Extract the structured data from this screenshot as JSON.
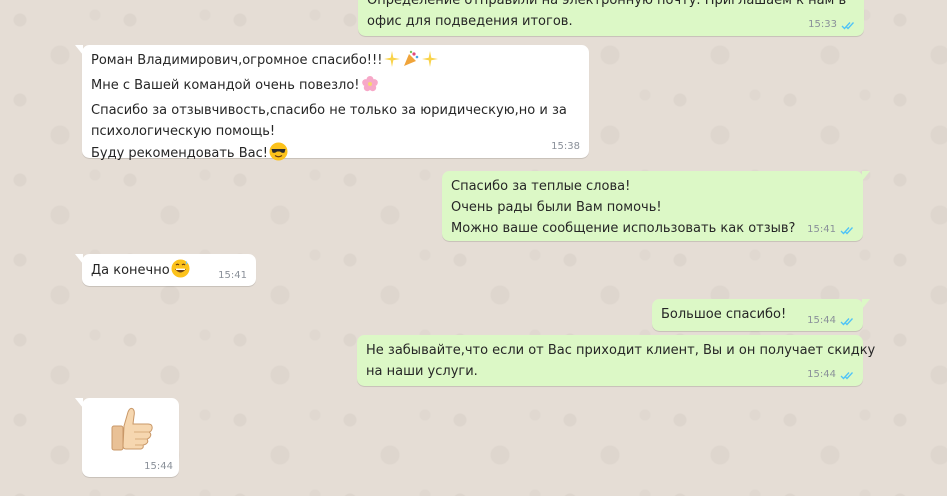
{
  "messages": [
    {
      "lines": [
        "Определение отправили на электронную почту. Приглашаем к нам в",
        "офис для подведения итогов."
      ],
      "time": "15:33"
    },
    {
      "lines": [
        "Роман Владимирович,огромное спасибо!!!",
        "Мне с Вашей командой очень повезло!",
        "Спасибо за отзывчивость,спасибо не только за юридическую,но и за",
        "психологическую помощь!",
        "Буду рекомендовать Вас!"
      ],
      "time": "15:38"
    },
    {
      "lines": [
        "Спасибо за теплые слова!",
        "Очень рады были Вам помочь!",
        "Можно ваше сообщение использовать как отзыв?"
      ],
      "time": "15:41"
    },
    {
      "lines": [
        "Да конечно"
      ],
      "time": "15:41"
    },
    {
      "lines": [
        "Большое спасибо!"
      ],
      "time": "15:44"
    },
    {
      "lines": [
        "Не забывайте,что если от Вас приходит клиент, Вы и он  получает скидку",
        "на наши услуги."
      ],
      "time": "15:44"
    },
    {
      "sticker": "thumbs-up",
      "time": "15:44"
    }
  ],
  "colors": {
    "background": "#e5ddd5",
    "incoming": "#ffffff",
    "outgoing": "#dcf8c6",
    "read_ticks": "#4fc3f7"
  },
  "icons": [
    "double-check-read-icon",
    "sparkles-emoji",
    "party-popper-emoji",
    "cherry-blossom-emoji",
    "sunglasses-emoji",
    "grinning-sweat-emoji",
    "thumbs-up-emoji"
  ]
}
